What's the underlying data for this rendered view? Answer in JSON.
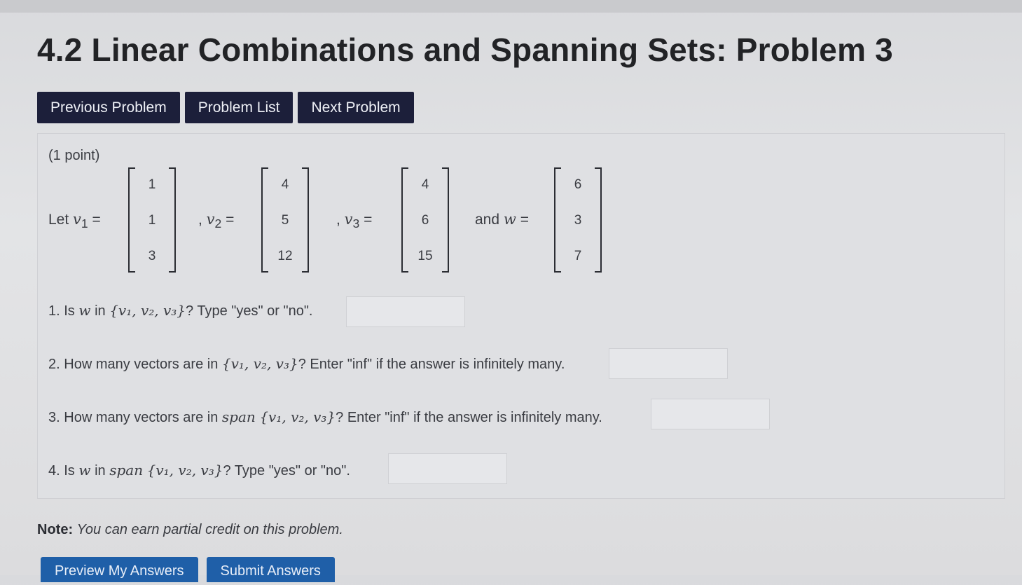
{
  "title": "4.2 Linear Combinations and Spanning Sets: Problem 3",
  "nav": {
    "previous": "Previous Problem",
    "list": "Problem List",
    "next": "Next Problem"
  },
  "problem": {
    "points": "(1 point)",
    "let_text": "Let",
    "v1_label": "v",
    "v1_sub": "1",
    "v2_label": "v",
    "v2_sub": "2",
    "v3_label": "v",
    "v3_sub": "3",
    "and_w": "and",
    "w_label": "w",
    "equals": "=",
    "v1": [
      "1",
      "1",
      "3"
    ],
    "v2": [
      "4",
      "5",
      "12"
    ],
    "v3": [
      "4",
      "6",
      "15"
    ],
    "w": [
      "6",
      "3",
      "7"
    ]
  },
  "questions": [
    {
      "num": "1.",
      "pre": "Is",
      "var": "w",
      "mid": "in",
      "set": "{v₁, v₂, v₃}",
      "post": "? Type \"yes\" or \"no\".",
      "answer": ""
    },
    {
      "num": "2.",
      "pre": "How many vectors are in",
      "set": "{v₁, v₂, v₃}",
      "post": "? Enter \"inf\" if the answer is infinitely many.",
      "answer": ""
    },
    {
      "num": "3.",
      "pre": "How many vectors are in",
      "span": "span",
      "set": "{v₁, v₂, v₃}",
      "post": "? Enter \"inf\" if the answer is infinitely many.",
      "answer": ""
    },
    {
      "num": "4.",
      "pre": "Is",
      "var": "w",
      "mid": "in",
      "span": "span",
      "set": "{v₁, v₂, v₃}",
      "post": "? Type \"yes\" or \"no\".",
      "answer": ""
    }
  ],
  "note": {
    "label": "Note:",
    "text": "You can earn partial credit on this problem."
  },
  "buttons": {
    "preview": "Preview My Answers",
    "submit": "Submit Answers"
  }
}
